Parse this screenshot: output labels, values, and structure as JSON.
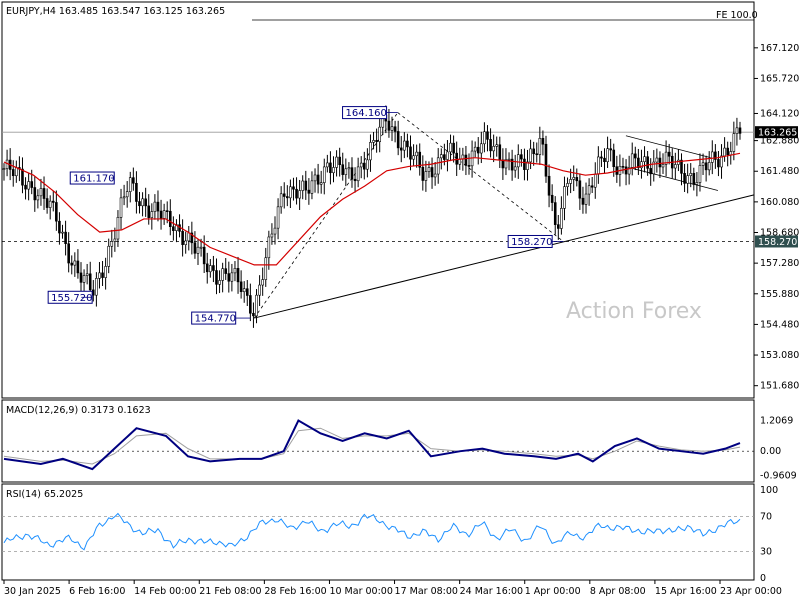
{
  "header": {
    "symbol_line": "EURJPY,H4  163.485 163.547 163.125 163.265",
    "macd_label": "MACD(12,26,9) 0.3173 0.1623",
    "rsi_label": "RSI(14) 65.2025",
    "watermark": "Action Forex",
    "fe_label": "FE 100.0"
  },
  "colors": {
    "candle": "#000000",
    "ma": "#d40000",
    "trendline": "#000000",
    "macd_line": "#000080",
    "signal_line": "#a0a0a0",
    "rsi_line": "#1e90ff",
    "annotation": "#000080",
    "current_price_bg": "#000000",
    "support_bg": "#2f4f4f"
  },
  "chart_data": {
    "type": "candlestick",
    "price_axis": {
      "ticks": [
        "167.120",
        "165.720",
        "164.120",
        "162.880",
        "161.480",
        "160.080",
        "158.680",
        "157.280",
        "155.880",
        "154.480",
        "153.080",
        "151.680"
      ],
      "tick_values": [
        167.12,
        165.72,
        164.12,
        162.88,
        161.48,
        160.08,
        158.68,
        157.28,
        155.88,
        154.48,
        153.08,
        151.68
      ],
      "ylim": [
        151.3,
        168.3
      ]
    },
    "time_axis": {
      "labels": [
        "30 Jan 2025",
        "6 Feb 16:00",
        "14 Feb 00:00",
        "21 Feb 08:00",
        "28 Feb 16:00",
        "10 Mar 00:00",
        "17 Mar 08:00",
        "24 Mar 16:00",
        "1 Apr 00:00",
        "8 Apr 08:00",
        "15 Apr 16:00",
        "23 Apr 00:00"
      ]
    },
    "current_price": {
      "label": "163.265",
      "value": 163.265
    },
    "support_level": {
      "label": "158.270",
      "value": 158.27
    },
    "annotations": [
      {
        "label": "161.170",
        "value": 161.17
      },
      {
        "label": "155.720",
        "value": 155.72
      },
      {
        "label": "164.160",
        "value": 164.16
      },
      {
        "label": "154.770",
        "value": 154.77
      },
      {
        "label": "158.270",
        "value": 158.27
      }
    ],
    "price_series": [
      {
        "x": 0.0,
        "y": 161.6
      },
      {
        "x": 0.04,
        "y": 160.8
      },
      {
        "x": 0.07,
        "y": 159.4
      },
      {
        "x": 0.1,
        "y": 156.8
      },
      {
        "x": 0.12,
        "y": 155.9
      },
      {
        "x": 0.15,
        "y": 158.6
      },
      {
        "x": 0.17,
        "y": 161.0
      },
      {
        "x": 0.2,
        "y": 159.6
      },
      {
        "x": 0.23,
        "y": 159.2
      },
      {
        "x": 0.26,
        "y": 157.8
      },
      {
        "x": 0.29,
        "y": 156.8
      },
      {
        "x": 0.32,
        "y": 156.4
      },
      {
        "x": 0.34,
        "y": 155.2
      },
      {
        "x": 0.36,
        "y": 157.9
      },
      {
        "x": 0.38,
        "y": 160.8
      },
      {
        "x": 0.41,
        "y": 160.4
      },
      {
        "x": 0.44,
        "y": 161.9
      },
      {
        "x": 0.47,
        "y": 161.2
      },
      {
        "x": 0.5,
        "y": 162.5
      },
      {
        "x": 0.52,
        "y": 163.9
      },
      {
        "x": 0.54,
        "y": 162.8
      },
      {
        "x": 0.57,
        "y": 161.3
      },
      {
        "x": 0.6,
        "y": 162.3
      },
      {
        "x": 0.62,
        "y": 161.9
      },
      {
        "x": 0.65,
        "y": 162.8
      },
      {
        "x": 0.68,
        "y": 162.1
      },
      {
        "x": 0.71,
        "y": 161.6
      },
      {
        "x": 0.73,
        "y": 163.2
      },
      {
        "x": 0.75,
        "y": 158.5
      },
      {
        "x": 0.77,
        "y": 161.5
      },
      {
        "x": 0.79,
        "y": 160.2
      },
      {
        "x": 0.82,
        "y": 162.5
      },
      {
        "x": 0.84,
        "y": 161.5
      },
      {
        "x": 0.86,
        "y": 161.8
      },
      {
        "x": 0.89,
        "y": 162.0
      },
      {
        "x": 0.91,
        "y": 161.7
      },
      {
        "x": 0.94,
        "y": 161.2
      },
      {
        "x": 0.97,
        "y": 162.1
      },
      {
        "x": 1.0,
        "y": 163.3
      }
    ],
    "ma_series": [
      {
        "x": 0.0,
        "y": 161.9
      },
      {
        "x": 0.04,
        "y": 161.3
      },
      {
        "x": 0.07,
        "y": 160.5
      },
      {
        "x": 0.1,
        "y": 159.5
      },
      {
        "x": 0.13,
        "y": 158.7
      },
      {
        "x": 0.16,
        "y": 158.8
      },
      {
        "x": 0.19,
        "y": 159.3
      },
      {
        "x": 0.22,
        "y": 159.3
      },
      {
        "x": 0.25,
        "y": 158.7
      },
      {
        "x": 0.28,
        "y": 158.0
      },
      {
        "x": 0.31,
        "y": 157.6
      },
      {
        "x": 0.34,
        "y": 157.2
      },
      {
        "x": 0.37,
        "y": 157.2
      },
      {
        "x": 0.4,
        "y": 158.3
      },
      {
        "x": 0.43,
        "y": 159.4
      },
      {
        "x": 0.46,
        "y": 160.2
      },
      {
        "x": 0.49,
        "y": 160.8
      },
      {
        "x": 0.52,
        "y": 161.5
      },
      {
        "x": 0.55,
        "y": 161.7
      },
      {
        "x": 0.58,
        "y": 161.8
      },
      {
        "x": 0.61,
        "y": 162.0
      },
      {
        "x": 0.64,
        "y": 162.1
      },
      {
        "x": 0.67,
        "y": 162.0
      },
      {
        "x": 0.7,
        "y": 161.9
      },
      {
        "x": 0.73,
        "y": 161.8
      },
      {
        "x": 0.76,
        "y": 161.5
      },
      {
        "x": 0.79,
        "y": 161.3
      },
      {
        "x": 0.82,
        "y": 161.4
      },
      {
        "x": 0.85,
        "y": 161.6
      },
      {
        "x": 0.88,
        "y": 161.8
      },
      {
        "x": 0.91,
        "y": 161.9
      },
      {
        "x": 0.94,
        "y": 162.0
      },
      {
        "x": 0.97,
        "y": 162.1
      },
      {
        "x": 1.0,
        "y": 162.3
      }
    ],
    "macd": {
      "ticks": [
        "1.2069",
        "0.00",
        "-0.9609"
      ],
      "tick_values": [
        1.2069,
        0.0,
        -0.9609
      ],
      "ylim": [
        -1.05,
        1.3
      ],
      "macd_series": [
        {
          "x": 0.0,
          "y": -0.3
        },
        {
          "x": 0.05,
          "y": -0.5
        },
        {
          "x": 0.08,
          "y": -0.3
        },
        {
          "x": 0.12,
          "y": -0.7
        },
        {
          "x": 0.15,
          "y": 0.1
        },
        {
          "x": 0.18,
          "y": 0.9
        },
        {
          "x": 0.22,
          "y": 0.6
        },
        {
          "x": 0.25,
          "y": -0.2
        },
        {
          "x": 0.28,
          "y": -0.4
        },
        {
          "x": 0.32,
          "y": -0.3
        },
        {
          "x": 0.35,
          "y": -0.3
        },
        {
          "x": 0.38,
          "y": 0.0
        },
        {
          "x": 0.4,
          "y": 1.2
        },
        {
          "x": 0.43,
          "y": 0.7
        },
        {
          "x": 0.46,
          "y": 0.4
        },
        {
          "x": 0.49,
          "y": 0.7
        },
        {
          "x": 0.52,
          "y": 0.5
        },
        {
          "x": 0.55,
          "y": 0.8
        },
        {
          "x": 0.58,
          "y": -0.2
        },
        {
          "x": 0.62,
          "y": 0.0
        },
        {
          "x": 0.65,
          "y": 0.1
        },
        {
          "x": 0.68,
          "y": -0.1
        },
        {
          "x": 0.72,
          "y": -0.2
        },
        {
          "x": 0.75,
          "y": -0.3
        },
        {
          "x": 0.78,
          "y": -0.1
        },
        {
          "x": 0.8,
          "y": -0.4
        },
        {
          "x": 0.83,
          "y": 0.2
        },
        {
          "x": 0.86,
          "y": 0.5
        },
        {
          "x": 0.89,
          "y": 0.1
        },
        {
          "x": 0.92,
          "y": 0.0
        },
        {
          "x": 0.95,
          "y": -0.1
        },
        {
          "x": 0.98,
          "y": 0.1
        },
        {
          "x": 1.0,
          "y": 0.32
        }
      ],
      "signal_series": [
        {
          "x": 0.0,
          "y": -0.2
        },
        {
          "x": 0.05,
          "y": -0.4
        },
        {
          "x": 0.08,
          "y": -0.35
        },
        {
          "x": 0.12,
          "y": -0.5
        },
        {
          "x": 0.15,
          "y": -0.1
        },
        {
          "x": 0.18,
          "y": 0.6
        },
        {
          "x": 0.22,
          "y": 0.7
        },
        {
          "x": 0.25,
          "y": 0.1
        },
        {
          "x": 0.28,
          "y": -0.3
        },
        {
          "x": 0.32,
          "y": -0.3
        },
        {
          "x": 0.35,
          "y": -0.3
        },
        {
          "x": 0.38,
          "y": -0.1
        },
        {
          "x": 0.4,
          "y": 0.8
        },
        {
          "x": 0.43,
          "y": 0.9
        },
        {
          "x": 0.46,
          "y": 0.5
        },
        {
          "x": 0.49,
          "y": 0.6
        },
        {
          "x": 0.52,
          "y": 0.6
        },
        {
          "x": 0.55,
          "y": 0.7
        },
        {
          "x": 0.58,
          "y": 0.1
        },
        {
          "x": 0.62,
          "y": 0.0
        },
        {
          "x": 0.65,
          "y": 0.05
        },
        {
          "x": 0.68,
          "y": 0.0
        },
        {
          "x": 0.72,
          "y": -0.1
        },
        {
          "x": 0.75,
          "y": -0.2
        },
        {
          "x": 0.78,
          "y": -0.15
        },
        {
          "x": 0.8,
          "y": -0.3
        },
        {
          "x": 0.83,
          "y": 0.0
        },
        {
          "x": 0.86,
          "y": 0.4
        },
        {
          "x": 0.89,
          "y": 0.2
        },
        {
          "x": 0.92,
          "y": 0.05
        },
        {
          "x": 0.95,
          "y": 0.0
        },
        {
          "x": 0.98,
          "y": 0.05
        },
        {
          "x": 1.0,
          "y": 0.16
        }
      ]
    },
    "rsi": {
      "ticks": [
        "100",
        "70",
        "30",
        "0"
      ],
      "tick_values": [
        100,
        70,
        30,
        0
      ],
      "ylim": [
        0,
        100
      ],
      "series": [
        {
          "x": 0.0,
          "y": 40
        },
        {
          "x": 0.03,
          "y": 50
        },
        {
          "x": 0.06,
          "y": 38
        },
        {
          "x": 0.09,
          "y": 45
        },
        {
          "x": 0.11,
          "y": 35
        },
        {
          "x": 0.13,
          "y": 60
        },
        {
          "x": 0.15,
          "y": 72
        },
        {
          "x": 0.17,
          "y": 60
        },
        {
          "x": 0.19,
          "y": 50
        },
        {
          "x": 0.21,
          "y": 55
        },
        {
          "x": 0.23,
          "y": 35
        },
        {
          "x": 0.25,
          "y": 45
        },
        {
          "x": 0.27,
          "y": 40
        },
        {
          "x": 0.29,
          "y": 42
        },
        {
          "x": 0.31,
          "y": 35
        },
        {
          "x": 0.33,
          "y": 48
        },
        {
          "x": 0.35,
          "y": 62
        },
        {
          "x": 0.37,
          "y": 68
        },
        {
          "x": 0.39,
          "y": 55
        },
        {
          "x": 0.41,
          "y": 66
        },
        {
          "x": 0.43,
          "y": 52
        },
        {
          "x": 0.45,
          "y": 62
        },
        {
          "x": 0.47,
          "y": 58
        },
        {
          "x": 0.49,
          "y": 70
        },
        {
          "x": 0.51,
          "y": 66
        },
        {
          "x": 0.53,
          "y": 55
        },
        {
          "x": 0.55,
          "y": 48
        },
        {
          "x": 0.57,
          "y": 52
        },
        {
          "x": 0.59,
          "y": 45
        },
        {
          "x": 0.61,
          "y": 58
        },
        {
          "x": 0.63,
          "y": 50
        },
        {
          "x": 0.65,
          "y": 62
        },
        {
          "x": 0.67,
          "y": 45
        },
        {
          "x": 0.69,
          "y": 55
        },
        {
          "x": 0.71,
          "y": 42
        },
        {
          "x": 0.73,
          "y": 60
        },
        {
          "x": 0.75,
          "y": 38
        },
        {
          "x": 0.77,
          "y": 52
        },
        {
          "x": 0.79,
          "y": 45
        },
        {
          "x": 0.81,
          "y": 62
        },
        {
          "x": 0.83,
          "y": 55
        },
        {
          "x": 0.85,
          "y": 58
        },
        {
          "x": 0.87,
          "y": 50
        },
        {
          "x": 0.89,
          "y": 56
        },
        {
          "x": 0.91,
          "y": 52
        },
        {
          "x": 0.93,
          "y": 60
        },
        {
          "x": 0.95,
          "y": 48
        },
        {
          "x": 0.97,
          "y": 58
        },
        {
          "x": 1.0,
          "y": 65.2
        }
      ]
    }
  }
}
